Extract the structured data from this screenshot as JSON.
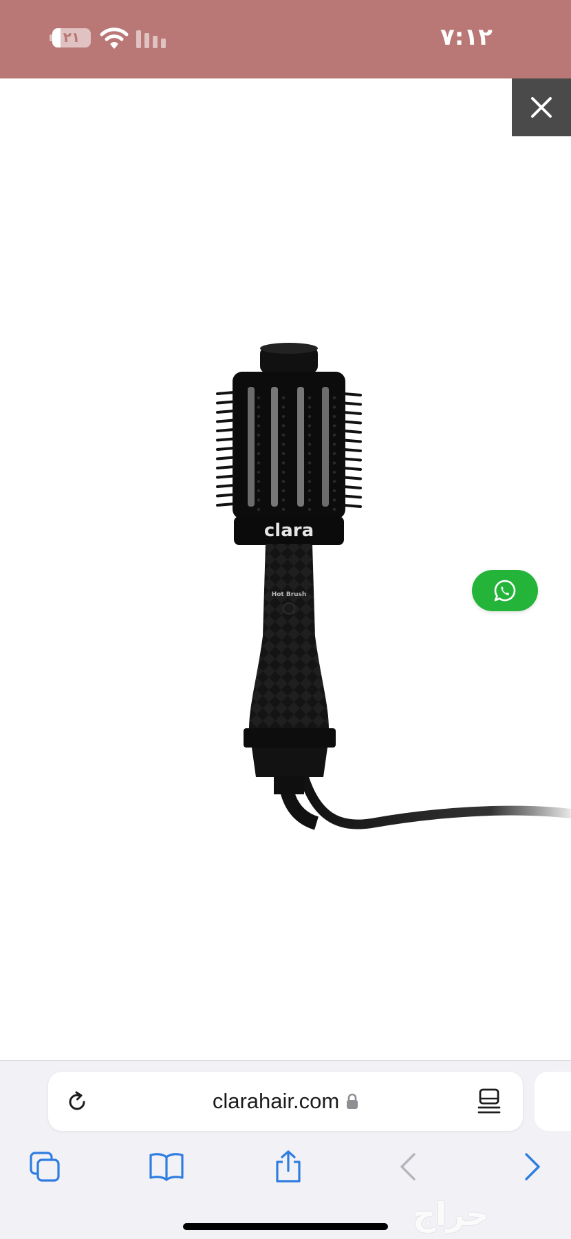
{
  "colors": {
    "status_bar_bg": "#b97876",
    "close_button_bg": "#4a4a4a",
    "whatsapp_green": "#25b43a",
    "toolbar_accent": "#2f7de1",
    "toolbar_disabled": "#b5b5bb"
  },
  "status_bar": {
    "time": "٧:١٢",
    "battery_level": "٢١",
    "battery_fraction": 0.21
  },
  "main": {
    "product": {
      "brand": "clara",
      "label": "Hot Brush"
    }
  },
  "browser": {
    "url": "clarahair.com",
    "watermark": "حراج"
  },
  "icons": {
    "close": "close-icon",
    "whatsapp": "whatsapp-icon",
    "reload": "reload-icon",
    "lock": "lock-icon",
    "reader": "reader-mode-icon",
    "tabs": "tabs-icon",
    "bookmarks": "bookmarks-icon",
    "share": "share-icon",
    "back": "back-arrow-icon",
    "forward": "forward-arrow-icon"
  }
}
